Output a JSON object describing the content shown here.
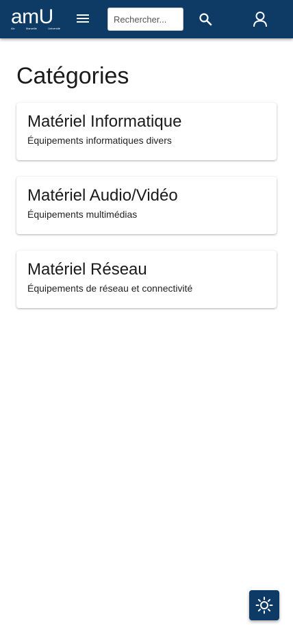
{
  "header": {
    "logo_text": "amU",
    "logo_sub": [
      "Aix",
      "Marseille",
      "Université"
    ],
    "menu_icon": "menu-icon",
    "search_placeholder": "Rechercher...",
    "search_value": "",
    "search_icon": "search-icon",
    "user_icon": "user-icon",
    "background_color": "#0e3a66"
  },
  "page": {
    "title": "Catégories"
  },
  "categories": [
    {
      "title": "Matériel Informatique",
      "description": "Équipements informatiques divers"
    },
    {
      "title": "Matériel Audio/Vidéo",
      "description": "Équipements multimédias"
    },
    {
      "title": "Matériel Réseau",
      "description": "Équipements de réseau et connectivité"
    }
  ],
  "theme_toggle": {
    "icon": "sun-icon",
    "background_color": "#0e3a66"
  }
}
